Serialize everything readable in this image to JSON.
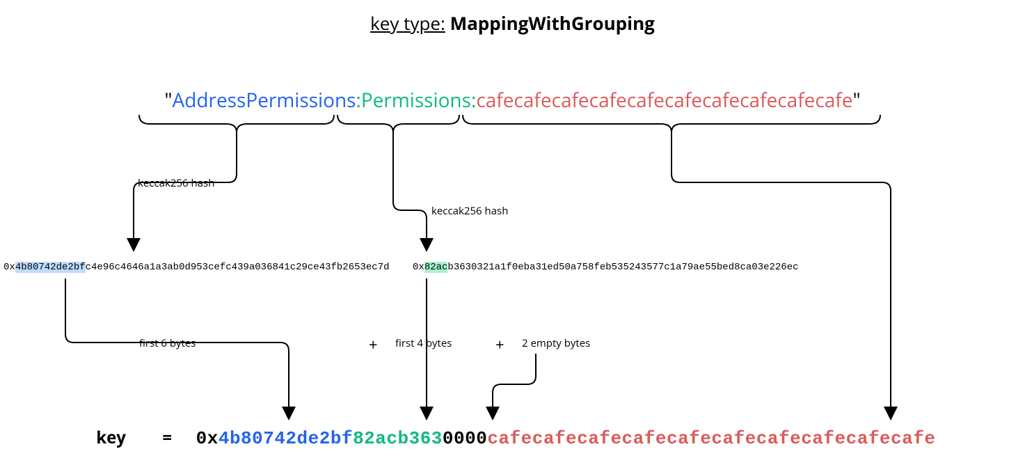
{
  "title": {
    "prefix": "key type:",
    "name": "MappingWithGrouping"
  },
  "input": {
    "part1": "AddressPermissions",
    "sep1": ":",
    "part2": "Permissions",
    "sep2": ":",
    "part3": "cafecafecafecafecafecafecafecafecafecafe",
    "quote_open": "\"",
    "quote_close": "\""
  },
  "labels": {
    "hash1": "keccak256 hash",
    "hash2": "keccak256 hash",
    "first6": "first 6 bytes",
    "first4": "first 4 bytes",
    "empty2": "2 empty bytes"
  },
  "hash1": {
    "prefix": "0x",
    "highlight": "4b80742de2bf",
    "rest": "c4e96c4646a1a3ab0d953cefc439a036841c29ce43fb2653ec7d"
  },
  "hash2": {
    "prefix": "0x",
    "highlight": "82ac",
    "rest": "b3630321a1f0eba31ed50a758feb535243577c1a79ae55bed8ca03e226ec"
  },
  "ops": {
    "plus": "+",
    "equals": "="
  },
  "result": {
    "label": "key",
    "prefix": "0x",
    "part1": "4b80742de2bf",
    "part2": "82acb363",
    "part3": "0000",
    "part4": "cafecafecafecafecafecafecafecafecafecafe"
  }
}
